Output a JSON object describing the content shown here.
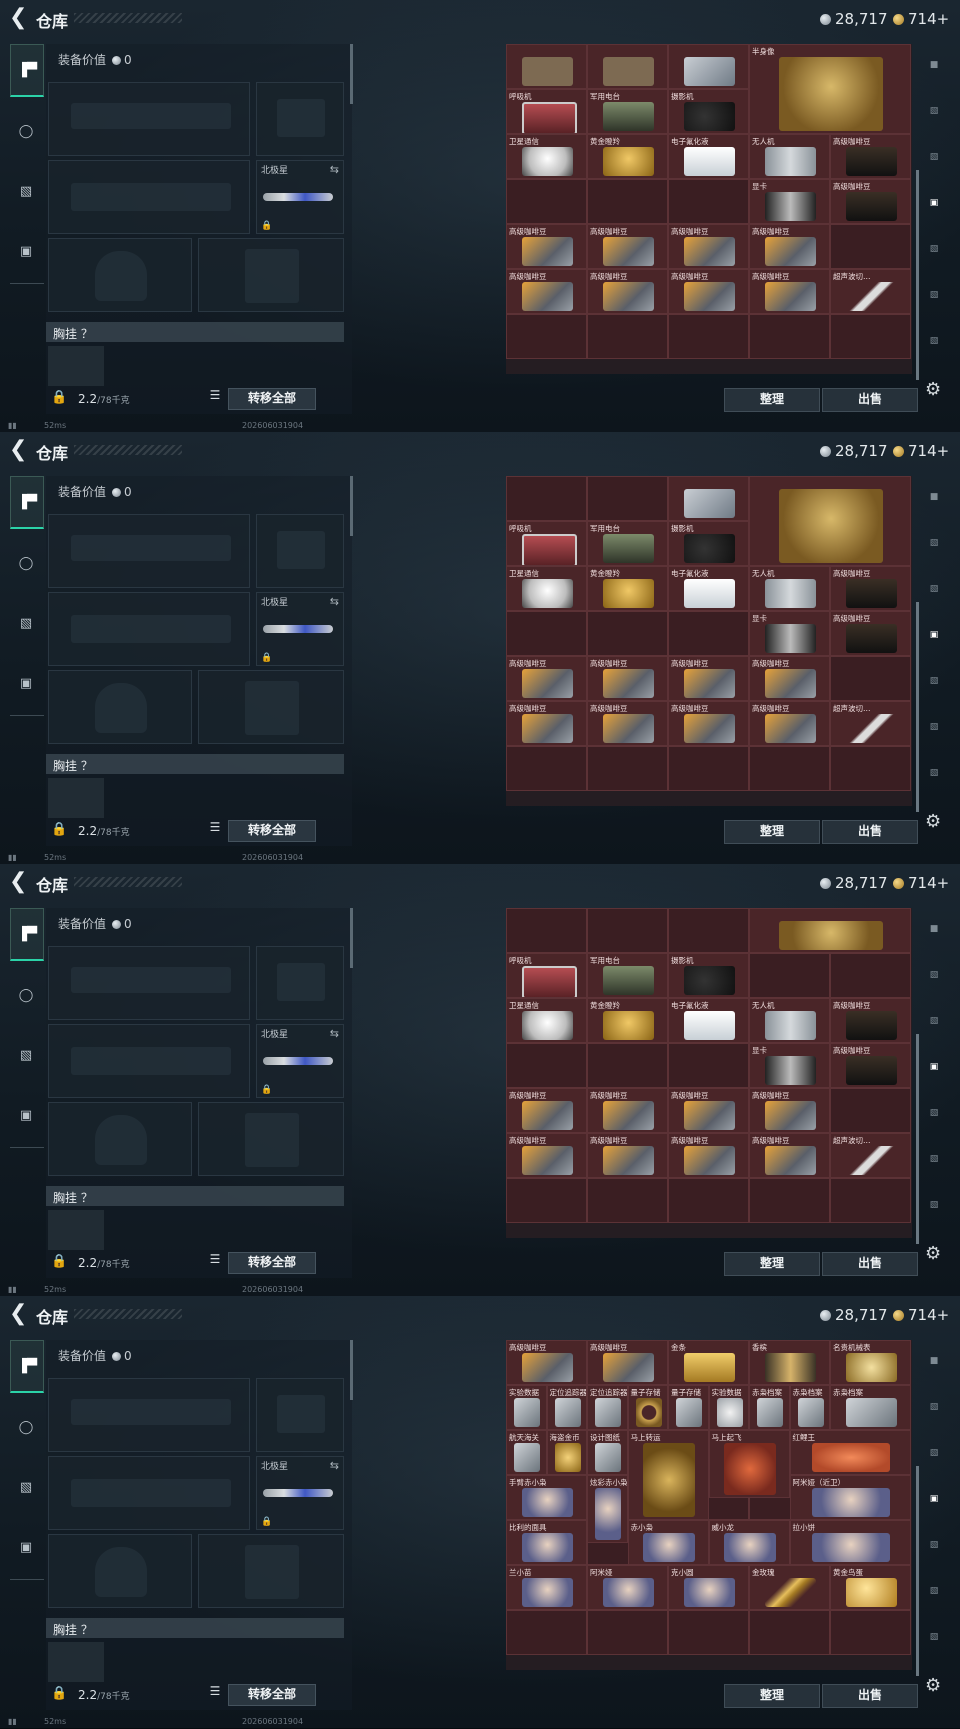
{
  "frames": [
    {
      "header": {
        "title": "仓库",
        "silver": "28,717",
        "gold": "714+"
      },
      "loadout": {
        "value_label": "装备价值",
        "value": "0",
        "knife_label": "北极星",
        "vest_label": "胸挂 ？",
        "weight": "2.2",
        "weight_max": "/78千克",
        "transfer_label": "转移全部"
      },
      "actions": {
        "sort": "整理",
        "sell": "出售"
      },
      "status": {
        "ping": "52ms",
        "stamp": "202606031904"
      },
      "inventory": [
        {
          "label": "",
          "col": 0,
          "row": 0,
          "w": 1,
          "h": 1,
          "art": "item"
        },
        {
          "label": "",
          "col": 1,
          "row": 0,
          "w": 1,
          "h": 1,
          "art": "item"
        },
        {
          "label": "",
          "col": 2,
          "row": 0,
          "w": 1,
          "h": 1,
          "art": "tool"
        },
        {
          "label": "半身像",
          "col": 3,
          "row": 0,
          "w": 2,
          "h": 2,
          "art": "bust"
        },
        {
          "label": "呼吸机",
          "col": 0,
          "row": 1,
          "w": 1,
          "h": 1,
          "art": "device"
        },
        {
          "label": "军用电台",
          "col": 1,
          "row": 1,
          "w": 1,
          "h": 1,
          "art": "radio"
        },
        {
          "label": "摄影机",
          "col": 2,
          "row": 1,
          "w": 1,
          "h": 1,
          "art": "camera"
        },
        {
          "label": "无人机",
          "col": 3,
          "row": 2,
          "w": 1,
          "h": 1,
          "art": "drone"
        },
        {
          "label": "高级咖啡豆",
          "col": 4,
          "row": 2,
          "w": 1,
          "h": 1,
          "art": "coffee"
        },
        {
          "label": "卫星通信",
          "col": 0,
          "row": 2,
          "w": 1,
          "h": 1,
          "art": "dish"
        },
        {
          "label": "黄金瞪羚",
          "col": 1,
          "row": 2,
          "w": 1,
          "h": 1,
          "art": "gold"
        },
        {
          "label": "电子氟化液",
          "col": 2,
          "row": 2,
          "w": 1,
          "h": 1,
          "art": "jug"
        },
        {
          "label": "显卡",
          "col": 3,
          "row": 3,
          "w": 1,
          "h": 1,
          "art": "gpu"
        },
        {
          "label": "高级咖啡豆",
          "col": 4,
          "row": 3,
          "w": 1,
          "h": 1,
          "art": "coffee"
        },
        {
          "label": "高级咖啡豆",
          "col": 0,
          "row": 4,
          "w": 1,
          "h": 1,
          "art": "beans"
        },
        {
          "label": "高级咖啡豆",
          "col": 1,
          "row": 4,
          "w": 1,
          "h": 1,
          "art": "beans"
        },
        {
          "label": "高级咖啡豆",
          "col": 2,
          "row": 4,
          "w": 1,
          "h": 1,
          "art": "beans"
        },
        {
          "label": "高级咖啡豆",
          "col": 3,
          "row": 4,
          "w": 1,
          "h": 1,
          "art": "beans"
        },
        {
          "label": "高级咖啡豆",
          "col": 0,
          "row": 5,
          "w": 1,
          "h": 1,
          "art": "beans"
        },
        {
          "label": "高级咖啡豆",
          "col": 1,
          "row": 5,
          "w": 1,
          "h": 1,
          "art": "beans"
        },
        {
          "label": "高级咖啡豆",
          "col": 2,
          "row": 5,
          "w": 1,
          "h": 1,
          "art": "beans"
        },
        {
          "label": "高级咖啡豆",
          "col": 3,
          "row": 5,
          "w": 1,
          "h": 1,
          "art": "beans"
        },
        {
          "label": "超声波切…",
          "col": 4,
          "row": 5,
          "w": 1,
          "h": 1,
          "art": "pen"
        }
      ]
    },
    {
      "header": {
        "title": "仓库",
        "silver": "28,717",
        "gold": "714+"
      },
      "loadout": {
        "value_label": "装备价值",
        "value": "0",
        "knife_label": "北极星",
        "vest_label": "胸挂 ？",
        "weight": "2.2",
        "weight_max": "/78千克",
        "transfer_label": "转移全部"
      },
      "actions": {
        "sort": "整理",
        "sell": "出售"
      },
      "status": {
        "ping": "52ms",
        "stamp": "202606031904"
      },
      "inventory": [
        {
          "label": "",
          "col": 2,
          "row": 0,
          "w": 1,
          "h": 1,
          "art": "tool"
        },
        {
          "label": "",
          "col": 3,
          "row": 0,
          "w": 2,
          "h": 2,
          "art": "bust"
        },
        {
          "label": "呼吸机",
          "col": 0,
          "row": 1,
          "w": 1,
          "h": 1,
          "art": "device"
        },
        {
          "label": "军用电台",
          "col": 1,
          "row": 1,
          "w": 1,
          "h": 1,
          "art": "radio"
        },
        {
          "label": "摄影机",
          "col": 2,
          "row": 1,
          "w": 1,
          "h": 1,
          "art": "camera"
        },
        {
          "label": "无人机",
          "col": 3,
          "row": 2,
          "w": 1,
          "h": 1,
          "art": "drone"
        },
        {
          "label": "高级咖啡豆",
          "col": 4,
          "row": 2,
          "w": 1,
          "h": 1,
          "art": "coffee"
        },
        {
          "label": "卫星通信",
          "col": 0,
          "row": 2,
          "w": 1,
          "h": 1,
          "art": "dish"
        },
        {
          "label": "黄金瞪羚",
          "col": 1,
          "row": 2,
          "w": 1,
          "h": 1,
          "art": "gold"
        },
        {
          "label": "电子氟化液",
          "col": 2,
          "row": 2,
          "w": 1,
          "h": 1,
          "art": "jug"
        },
        {
          "label": "显卡",
          "col": 3,
          "row": 3,
          "w": 1,
          "h": 1,
          "art": "gpu"
        },
        {
          "label": "高级咖啡豆",
          "col": 4,
          "row": 3,
          "w": 1,
          "h": 1,
          "art": "coffee"
        },
        {
          "label": "高级咖啡豆",
          "col": 0,
          "row": 4,
          "w": 1,
          "h": 1,
          "art": "beans"
        },
        {
          "label": "高级咖啡豆",
          "col": 1,
          "row": 4,
          "w": 1,
          "h": 1,
          "art": "beans"
        },
        {
          "label": "高级咖啡豆",
          "col": 2,
          "row": 4,
          "w": 1,
          "h": 1,
          "art": "beans"
        },
        {
          "label": "高级咖啡豆",
          "col": 3,
          "row": 4,
          "w": 1,
          "h": 1,
          "art": "beans"
        },
        {
          "label": "高级咖啡豆",
          "col": 0,
          "row": 5,
          "w": 1,
          "h": 1,
          "art": "beans"
        },
        {
          "label": "高级咖啡豆",
          "col": 1,
          "row": 5,
          "w": 1,
          "h": 1,
          "art": "beans"
        },
        {
          "label": "高级咖啡豆",
          "col": 2,
          "row": 5,
          "w": 1,
          "h": 1,
          "art": "beans"
        },
        {
          "label": "高级咖啡豆",
          "col": 3,
          "row": 5,
          "w": 1,
          "h": 1,
          "art": "beans"
        },
        {
          "label": "超声波切…",
          "col": 4,
          "row": 5,
          "w": 1,
          "h": 1,
          "art": "pen"
        }
      ]
    },
    {
      "header": {
        "title": "仓库",
        "silver": "28,717",
        "gold": "714+"
      },
      "loadout": {
        "value_label": "装备价值",
        "value": "0",
        "knife_label": "北极星",
        "vest_label": "胸挂 ？",
        "weight": "2.2",
        "weight_max": "/78千克",
        "transfer_label": "转移全部"
      },
      "actions": {
        "sort": "整理",
        "sell": "出售"
      },
      "status": {
        "ping": "52ms",
        "stamp": "202606031904"
      },
      "inventory": [
        {
          "label": "",
          "col": 3,
          "row": 0,
          "w": 2,
          "h": 1,
          "art": "bust"
        },
        {
          "label": "呼吸机",
          "col": 0,
          "row": 1,
          "w": 1,
          "h": 1,
          "art": "device"
        },
        {
          "label": "军用电台",
          "col": 1,
          "row": 1,
          "w": 1,
          "h": 1,
          "art": "radio"
        },
        {
          "label": "摄影机",
          "col": 2,
          "row": 1,
          "w": 1,
          "h": 1,
          "art": "camera"
        },
        {
          "label": "无人机",
          "col": 3,
          "row": 2,
          "w": 1,
          "h": 1,
          "art": "drone"
        },
        {
          "label": "高级咖啡豆",
          "col": 4,
          "row": 2,
          "w": 1,
          "h": 1,
          "art": "coffee"
        },
        {
          "label": "卫星通信",
          "col": 0,
          "row": 2,
          "w": 1,
          "h": 1,
          "art": "dish"
        },
        {
          "label": "黄金瞪羚",
          "col": 1,
          "row": 2,
          "w": 1,
          "h": 1,
          "art": "gold"
        },
        {
          "label": "电子氟化液",
          "col": 2,
          "row": 2,
          "w": 1,
          "h": 1,
          "art": "jug"
        },
        {
          "label": "显卡",
          "col": 3,
          "row": 3,
          "w": 1,
          "h": 1,
          "art": "gpu"
        },
        {
          "label": "高级咖啡豆",
          "col": 4,
          "row": 3,
          "w": 1,
          "h": 1,
          "art": "coffee"
        },
        {
          "label": "高级咖啡豆",
          "col": 0,
          "row": 4,
          "w": 1,
          "h": 1,
          "art": "beans"
        },
        {
          "label": "高级咖啡豆",
          "col": 1,
          "row": 4,
          "w": 1,
          "h": 1,
          "art": "beans"
        },
        {
          "label": "高级咖啡豆",
          "col": 2,
          "row": 4,
          "w": 1,
          "h": 1,
          "art": "beans"
        },
        {
          "label": "高级咖啡豆",
          "col": 3,
          "row": 4,
          "w": 1,
          "h": 1,
          "art": "beans"
        },
        {
          "label": "高级咖啡豆",
          "col": 0,
          "row": 5,
          "w": 1,
          "h": 1,
          "art": "beans"
        },
        {
          "label": "高级咖啡豆",
          "col": 1,
          "row": 5,
          "w": 1,
          "h": 1,
          "art": "beans"
        },
        {
          "label": "高级咖啡豆",
          "col": 2,
          "row": 5,
          "w": 1,
          "h": 1,
          "art": "beans"
        },
        {
          "label": "高级咖啡豆",
          "col": 3,
          "row": 5,
          "w": 1,
          "h": 1,
          "art": "beans"
        },
        {
          "label": "超声波切…",
          "col": 4,
          "row": 5,
          "w": 1,
          "h": 1,
          "art": "pen"
        }
      ]
    },
    {
      "header": {
        "title": "仓库",
        "silver": "28,717",
        "gold": "714+"
      },
      "loadout": {
        "value_label": "装备价值",
        "value": "0",
        "knife_label": "北极星",
        "vest_label": "胸挂 ？",
        "weight": "2.2",
        "weight_max": "/78千克",
        "transfer_label": "转移全部"
      },
      "actions": {
        "sort": "整理",
        "sell": "出售"
      },
      "status": {
        "ping": "52ms",
        "stamp": "202606031904"
      },
      "inventory": [
        {
          "label": "高级咖啡豆",
          "col": 0,
          "row": 0,
          "w": 1,
          "h": 1,
          "art": "beans"
        },
        {
          "label": "高级咖啡豆",
          "col": 1,
          "row": 0,
          "w": 1,
          "h": 1,
          "art": "beans"
        },
        {
          "label": "金条",
          "col": 2,
          "row": 0,
          "w": 1,
          "h": 1,
          "art": "goldbar"
        },
        {
          "label": "香槟",
          "col": 3,
          "row": 0,
          "w": 1,
          "h": 1,
          "art": "bottle"
        },
        {
          "label": "名贵机械表",
          "col": 4,
          "row": 0,
          "w": 1,
          "h": 1,
          "art": "watch"
        },
        {
          "label": "实验数据",
          "col": 0,
          "row": 1,
          "w": 0.5,
          "h": 1,
          "art": "small"
        },
        {
          "label": "定位追踪器",
          "col": 0.5,
          "row": 1,
          "w": 0.5,
          "h": 1,
          "art": "small"
        },
        {
          "label": "定位追踪器",
          "col": 1,
          "row": 1,
          "w": 0.5,
          "h": 1,
          "art": "small"
        },
        {
          "label": "量子存储",
          "col": 1.5,
          "row": 1,
          "w": 0.5,
          "h": 1,
          "art": "ring"
        },
        {
          "label": "量子存储",
          "col": 2,
          "row": 1,
          "w": 0.5,
          "h": 1,
          "art": "small"
        },
        {
          "label": "实验数据",
          "col": 2.5,
          "row": 1,
          "w": 0.5,
          "h": 1,
          "art": "disk"
        },
        {
          "label": "赤枭档案",
          "col": 3,
          "row": 1,
          "w": 0.5,
          "h": 1,
          "art": "small"
        },
        {
          "label": "赤枭档案",
          "col": 3.5,
          "row": 1,
          "w": 0.5,
          "h": 1,
          "art": "small"
        },
        {
          "label": "赤枭档案",
          "col": 4,
          "row": 1,
          "w": 1,
          "h": 1,
          "art": "small"
        },
        {
          "label": "航天海关",
          "col": 0,
          "row": 2,
          "w": 0.5,
          "h": 1,
          "art": "small"
        },
        {
          "label": "海盗金币",
          "col": 0.5,
          "row": 2,
          "w": 0.5,
          "h": 1,
          "art": "coin"
        },
        {
          "label": "设计图纸",
          "col": 1,
          "row": 2,
          "w": 0.5,
          "h": 1,
          "art": "small"
        },
        {
          "label": "马上转运",
          "col": 1.5,
          "row": 2,
          "w": 1,
          "h": 2,
          "art": "plate"
        },
        {
          "label": "马上起飞",
          "col": 2.5,
          "row": 2,
          "w": 1,
          "h": 1.5,
          "art": "horse"
        },
        {
          "label": "红鲤王",
          "col": 3.5,
          "row": 2,
          "w": 1.5,
          "h": 1,
          "art": "fish"
        },
        {
          "label": "手臂赤小枭",
          "col": 0,
          "row": 3,
          "w": 1,
          "h": 1,
          "art": "figure"
        },
        {
          "label": "炫彩赤小枭",
          "col": 1,
          "row": 3,
          "w": 0.5,
          "h": 1.5,
          "art": "figure"
        },
        {
          "label": "阿米娅（近卫）",
          "col": 3.5,
          "row": 3,
          "w": 1.5,
          "h": 1,
          "art": "figure"
        },
        {
          "label": "比利的面具",
          "col": 0,
          "row": 4,
          "w": 1,
          "h": 1,
          "art": "figure"
        },
        {
          "label": "赤小枭",
          "col": 1.5,
          "row": 4,
          "w": 1,
          "h": 1,
          "art": "figure"
        },
        {
          "label": "威小龙",
          "col": 2.5,
          "row": 4,
          "w": 1,
          "h": 1,
          "art": "figure"
        },
        {
          "label": "拉小饼",
          "col": 3.5,
          "row": 4,
          "w": 1.5,
          "h": 1,
          "art": "figure"
        },
        {
          "label": "兰小苗",
          "col": 0,
          "row": 5,
          "w": 1,
          "h": 1,
          "art": "figure"
        },
        {
          "label": "阿米娅",
          "col": 1,
          "row": 5,
          "w": 1,
          "h": 1,
          "art": "figure"
        },
        {
          "label": "克小圆",
          "col": 2,
          "row": 5,
          "w": 1,
          "h": 1,
          "art": "figure"
        },
        {
          "label": "金玫瑰",
          "col": 3,
          "row": 5,
          "w": 1,
          "h": 1,
          "art": "rose"
        },
        {
          "label": "黄金鸟蛋",
          "col": 4,
          "row": 5,
          "w": 1,
          "h": 1,
          "art": "egg"
        }
      ]
    }
  ],
  "colors": {
    "accent": "#2bd3a8",
    "cell": "#4a2528",
    "panel": "#14202a"
  },
  "icons": {
    "back": "back-chevron-icon",
    "pistol": "pistol-icon",
    "gear": "gear-icon",
    "lock": "lock-icon"
  }
}
